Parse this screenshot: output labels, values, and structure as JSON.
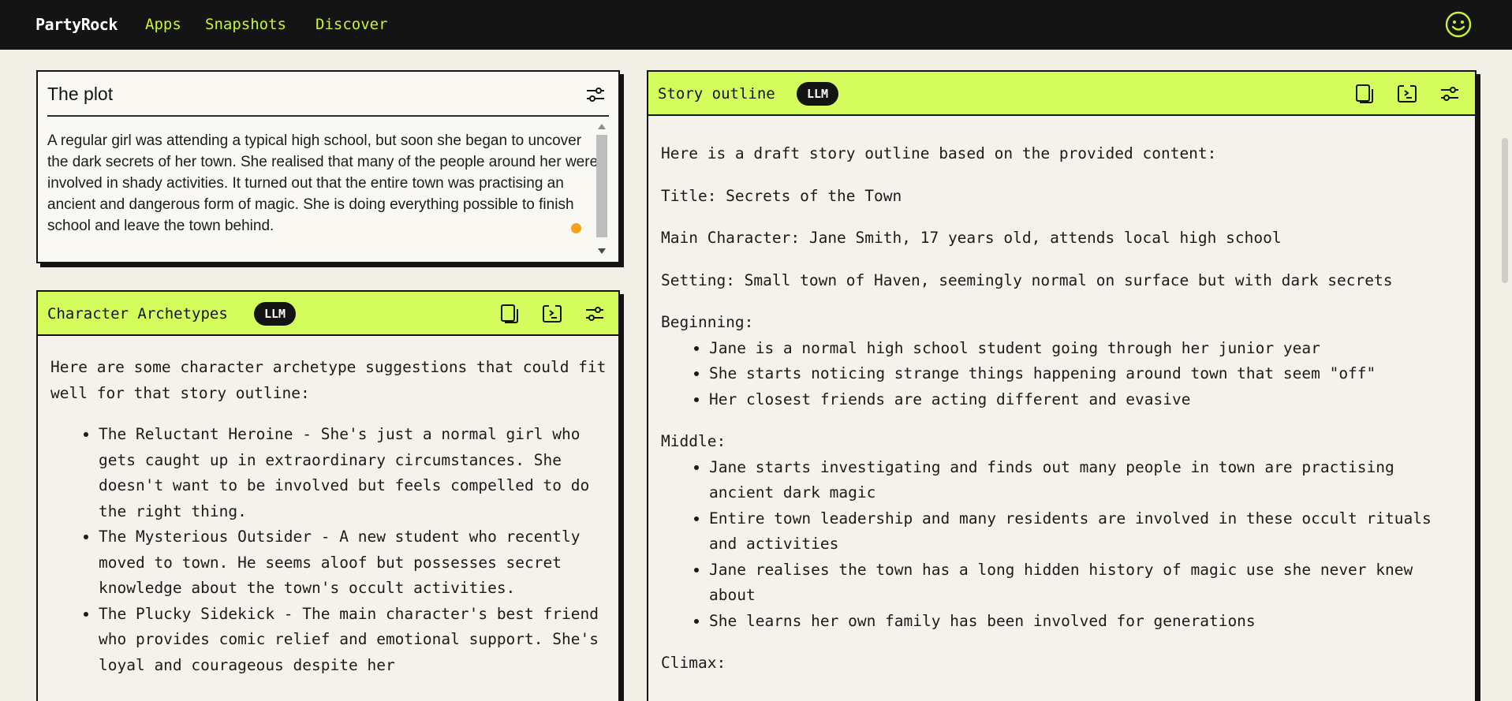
{
  "nav": {
    "brand": "PartyRock",
    "links": [
      "Apps",
      "Snapshots",
      "Discover"
    ],
    "profile_icon": "smiley-icon"
  },
  "plot_card": {
    "title": "The plot",
    "text": "A regular girl was attending a typical high school, but soon she began to uncover the dark secrets of her town. She realised that many of the people around her were involved in shady activities. It turned out that the entire town was practising an ancient and dangerous form of magic. She is doing everything possible to finish school and leave the town behind.",
    "settings_icon": "sliders-icon"
  },
  "archetypes_card": {
    "title": "Character Archetypes",
    "badge": "LLM",
    "intro": "Here are some character archetype suggestions that could fit well for that story outline:",
    "items": [
      "The Reluctant Heroine - She's just a normal girl who gets caught up in extraordinary circumstances. She doesn't want to be involved but feels compelled to do the right thing.",
      "The Mysterious Outsider - A new student who recently moved to town. He seems aloof but possesses secret knowledge about the town's occult activities.",
      "The Plucky Sidekick - The main character's best friend who provides comic relief and emotional support. She's loyal and courageous despite her"
    ],
    "icons": [
      "copy-icon",
      "share-icon",
      "sliders-icon"
    ]
  },
  "story_card": {
    "title": "Story outline",
    "badge": "LLM",
    "intro": "Here is a draft story outline based on the provided content:",
    "title_line": "Title: Secrets of the Town",
    "main_character": "Main Character: Jane Smith, 17 years old, attends local high school",
    "setting": "Setting: Small town of Haven, seemingly normal on surface but with dark secrets",
    "beginning_label": "Beginning:",
    "beginning_items": [
      "Jane is a normal high school student going through her junior year",
      "She starts noticing strange things happening around town that seem \"off\"",
      "Her closest friends are acting different and evasive"
    ],
    "middle_label": "Middle:",
    "middle_items": [
      "Jane starts investigating and finds out many people in town are practising ancient dark magic",
      "Entire town leadership and many residents are involved in these occult rituals and activities",
      "Jane realises the town has a long hidden history of magic use she never knew about",
      "She learns her own family has been involved for generations"
    ],
    "climax_label": "Climax:",
    "icons": [
      "copy-icon",
      "share-icon",
      "sliders-icon"
    ]
  },
  "colors": {
    "nav_bg": "#141414",
    "accent": "#c6f432",
    "header_bg": "#d4fc5c",
    "page_bg": "#f2f0e6"
  }
}
